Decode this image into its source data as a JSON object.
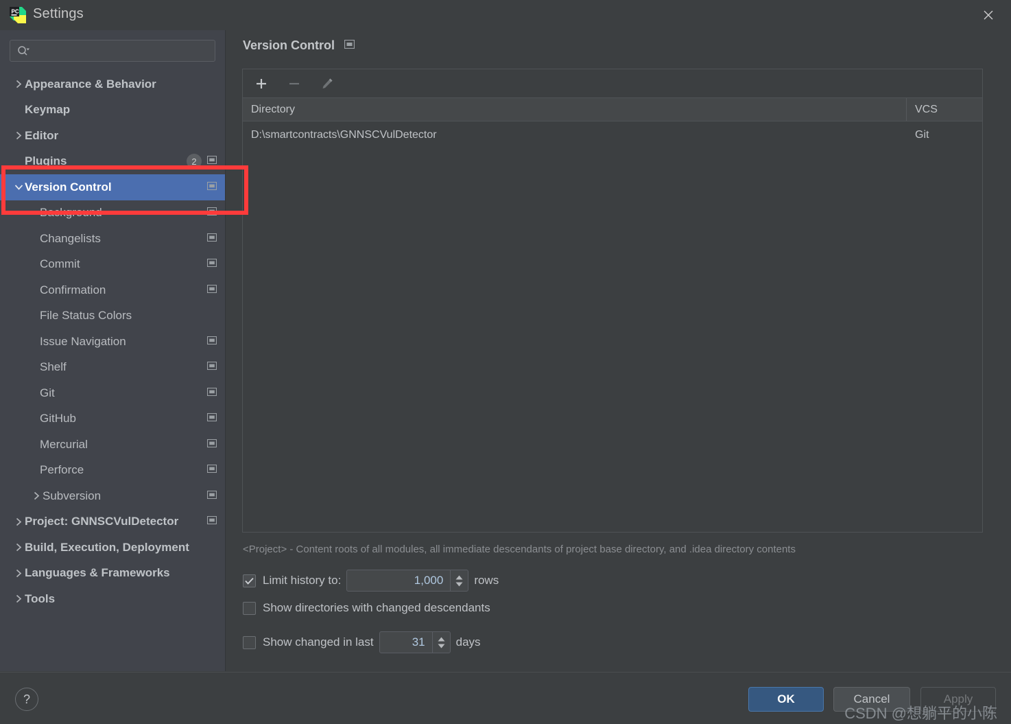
{
  "window": {
    "title": "Settings",
    "app_icon": "pycharm-logo-icon",
    "close_icon": "close-icon"
  },
  "sidebar": {
    "search": {
      "placeholder": "",
      "value": "",
      "icon": "search-icon"
    },
    "items": [
      {
        "label": "Appearance & Behavior",
        "indent": 0,
        "bold": true,
        "arrow": "right",
        "config_icon": false
      },
      {
        "label": "Keymap",
        "indent": 0,
        "bold": true,
        "arrow": "none",
        "config_icon": false
      },
      {
        "label": "Editor",
        "indent": 0,
        "bold": true,
        "arrow": "right",
        "config_icon": false
      },
      {
        "label": "Plugins",
        "indent": 0,
        "bold": true,
        "arrow": "none",
        "config_icon": true,
        "badge": "2"
      },
      {
        "label": "Version Control",
        "indent": 0,
        "bold": true,
        "arrow": "down",
        "config_icon": true,
        "selected": true
      },
      {
        "label": "Background",
        "indent": 1,
        "bold": false,
        "arrow": "none",
        "config_icon": true
      },
      {
        "label": "Changelists",
        "indent": 1,
        "bold": false,
        "arrow": "none",
        "config_icon": true
      },
      {
        "label": "Commit",
        "indent": 1,
        "bold": false,
        "arrow": "none",
        "config_icon": true
      },
      {
        "label": "Confirmation",
        "indent": 1,
        "bold": false,
        "arrow": "none",
        "config_icon": true
      },
      {
        "label": "File Status Colors",
        "indent": 1,
        "bold": false,
        "arrow": "none",
        "config_icon": false
      },
      {
        "label": "Issue Navigation",
        "indent": 1,
        "bold": false,
        "arrow": "none",
        "config_icon": true
      },
      {
        "label": "Shelf",
        "indent": 1,
        "bold": false,
        "arrow": "none",
        "config_icon": true
      },
      {
        "label": "Git",
        "indent": 1,
        "bold": false,
        "arrow": "none",
        "config_icon": true
      },
      {
        "label": "GitHub",
        "indent": 1,
        "bold": false,
        "arrow": "none",
        "config_icon": true
      },
      {
        "label": "Mercurial",
        "indent": 1,
        "bold": false,
        "arrow": "none",
        "config_icon": true
      },
      {
        "label": "Perforce",
        "indent": 1,
        "bold": false,
        "arrow": "none",
        "config_icon": true
      },
      {
        "label": "Subversion",
        "indent": 2,
        "bold": false,
        "arrow": "right",
        "config_icon": true
      },
      {
        "label": "Project: GNNSCVulDetector",
        "indent": 0,
        "bold": true,
        "arrow": "right",
        "config_icon": true
      },
      {
        "label": "Build, Execution, Deployment",
        "indent": 0,
        "bold": true,
        "arrow": "right",
        "config_icon": false
      },
      {
        "label": "Languages & Frameworks",
        "indent": 0,
        "bold": true,
        "arrow": "right",
        "config_icon": false
      },
      {
        "label": "Tools",
        "indent": 0,
        "bold": true,
        "arrow": "right",
        "config_icon": false
      }
    ]
  },
  "main": {
    "panel_title": "Version Control",
    "panel_title_icon": "reset-config-icon",
    "toolbar": {
      "add_label": "+",
      "remove_label": "−",
      "edit_icon": "pencil-icon"
    },
    "table": {
      "columns": [
        "Directory",
        "VCS"
      ],
      "rows": [
        {
          "directory": "D:\\smartcontracts\\GNNSCVulDetector",
          "vcs": "Git"
        }
      ]
    },
    "hint": "<Project> - Content roots of all modules, all immediate descendants of project base directory, and .idea directory contents",
    "options": {
      "limit_history": {
        "label": "Limit history to:",
        "checked": true,
        "value": "1,000",
        "suffix": "rows"
      },
      "show_directories": {
        "label": "Show directories with changed descendants",
        "checked": false
      },
      "show_changed_in_last": {
        "label": "Show changed in last",
        "checked": false,
        "value": "31",
        "suffix": "days"
      }
    }
  },
  "footer": {
    "help_label": "?",
    "ok_label": "OK",
    "cancel_label": "Cancel",
    "apply_label": "Apply"
  },
  "watermark": "CSDN @想躺平的小陈",
  "colors": {
    "window_bg": "#3c3f41",
    "sidebar_bg": "#41444b",
    "selection_blue": "#4b6eaf",
    "ok_button_blue": "#365880",
    "annotation_red": "#fe3b3b",
    "text": "#bfc2c6",
    "hint_text": "#8b8e92"
  }
}
